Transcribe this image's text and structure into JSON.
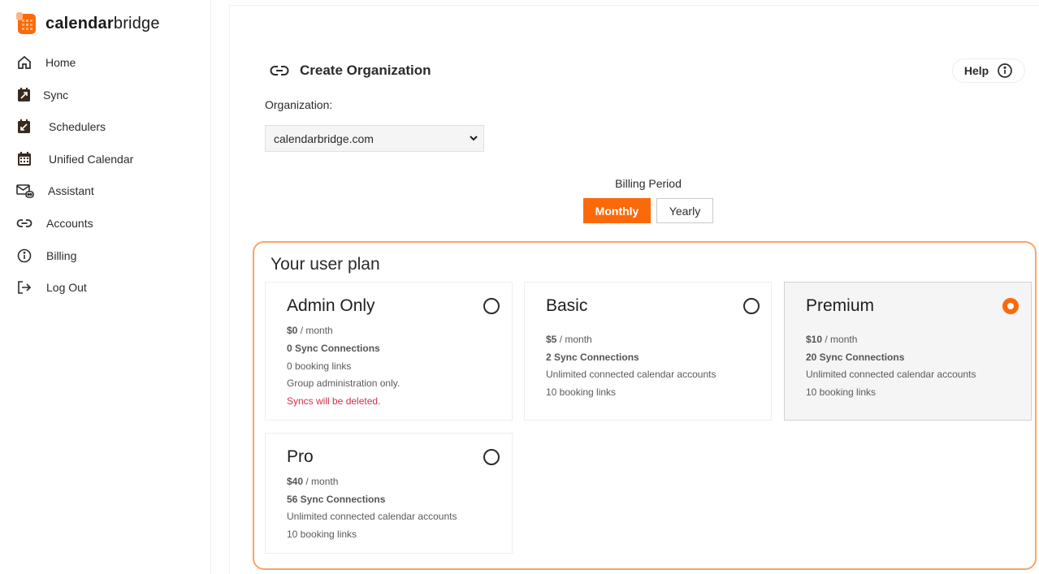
{
  "brand": {
    "name_bold": "calendar",
    "name_regular": "bridge"
  },
  "sidebar": {
    "items": [
      {
        "label": "Home",
        "icon": "home-icon"
      },
      {
        "label": "Sync",
        "icon": "sync-icon"
      },
      {
        "label": "Schedulers",
        "icon": "scheduler-icon"
      },
      {
        "label": "Unified Calendar",
        "icon": "calendar-icon"
      },
      {
        "label": "Assistant",
        "icon": "assistant-mail-icon"
      },
      {
        "label": "Accounts",
        "icon": "link-icon"
      },
      {
        "label": "Billing",
        "icon": "info-icon"
      },
      {
        "label": "Log Out",
        "icon": "logout-icon"
      }
    ]
  },
  "header": {
    "title": "Create Organization",
    "help_label": "Help"
  },
  "organization": {
    "label": "Organization:",
    "selected": "calendarbridge.com"
  },
  "billing": {
    "label": "Billing Period",
    "options": [
      "Monthly",
      "Yearly"
    ],
    "selected": "Monthly"
  },
  "plans": {
    "heading": "Your user plan",
    "selected": "Premium",
    "items": [
      {
        "name": "Admin Only",
        "price": "$0",
        "per": " / month",
        "connections": "0 Sync Connections",
        "line3": "0 booking links",
        "line4": "Group administration only.",
        "warning": "Syncs will be deleted."
      },
      {
        "name": "Basic",
        "price": "$5",
        "per": " / month",
        "connections": "2 Sync Connections",
        "line3": "Unlimited connected calendar accounts",
        "line4": "10 booking links"
      },
      {
        "name": "Premium",
        "price": "$10",
        "per": " / month",
        "connections": "20 Sync Connections",
        "line3": "Unlimited connected calendar accounts",
        "line4": "10 booking links"
      },
      {
        "name": "Pro",
        "price": "$40",
        "per": " / month",
        "connections": "56 Sync Connections",
        "line3": "Unlimited connected calendar accounts",
        "line4": "10 booking links"
      }
    ]
  },
  "colors": {
    "accent": "#fb6a0a",
    "plan_border": "#f7a56a",
    "warning": "#d72d4a"
  }
}
